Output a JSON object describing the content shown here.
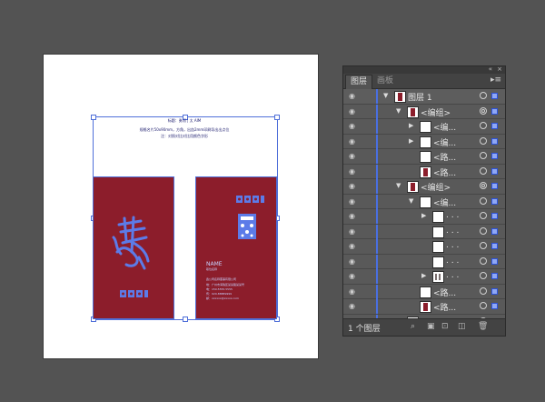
{
  "artboard": {
    "lines": [
      "标题：勇闯 | 太 AIM",
      "规格名片50x90mm，方角，出血2mm印刷导出出点位",
      "注：对照对比对比用颜色字形"
    ],
    "card_right": {
      "name": "NAME",
      "title": "职位名称",
      "info": [
        "鑫公司名称董事有限公司",
        "地：广州市海珠区某某路某某号",
        "电：150.5555.5555",
        "传：020-88889999",
        "邮：xxxxxx@xxxxx.com"
      ]
    }
  },
  "panel": {
    "tabs": [
      "图层",
      "画板"
    ],
    "menu_icon": "panel-menu-icon",
    "rows": [
      {
        "label": "图层 1",
        "arrow": "▼",
        "thumb": "red",
        "target": "single"
      },
      {
        "label": "<编组>",
        "arrow": "▼",
        "thumb": "red",
        "target": "double"
      },
      {
        "label": "<编...",
        "arrow": "▶",
        "thumb": "white",
        "target": "single"
      },
      {
        "label": "<编...",
        "arrow": "▶",
        "thumb": "white",
        "target": "single"
      },
      {
        "label": "<路...",
        "arrow": "",
        "thumb": "white",
        "target": "single"
      },
      {
        "label": "<路...",
        "arrow": "",
        "thumb": "red",
        "target": "single"
      },
      {
        "label": "<编组>",
        "arrow": "▼",
        "thumb": "red",
        "target": "double"
      },
      {
        "label": "<编...",
        "arrow": "▼",
        "thumb": "white",
        "target": "single"
      },
      {
        "label": ". . .",
        "arrow": "▶",
        "thumb": "white",
        "target": "single"
      },
      {
        "label": ". . .",
        "arrow": "",
        "thumb": "white",
        "target": "single"
      },
      {
        "label": ". . .",
        "arrow": "",
        "thumb": "white",
        "target": "single"
      },
      {
        "label": ". . .",
        "arrow": "",
        "thumb": "white",
        "target": "single"
      },
      {
        "label": ". . .",
        "arrow": "▶",
        "thumb": "pic",
        "target": "single"
      },
      {
        "label": "<路...",
        "arrow": "",
        "thumb": "white",
        "target": "single"
      },
      {
        "label": "<路...",
        "arrow": "",
        "thumb": "red",
        "target": "single"
      },
      {
        "label": "字体：...",
        "arrow": "",
        "thumb": "white",
        "target": "double"
      }
    ],
    "footer": {
      "label": "1 个图层"
    }
  }
}
